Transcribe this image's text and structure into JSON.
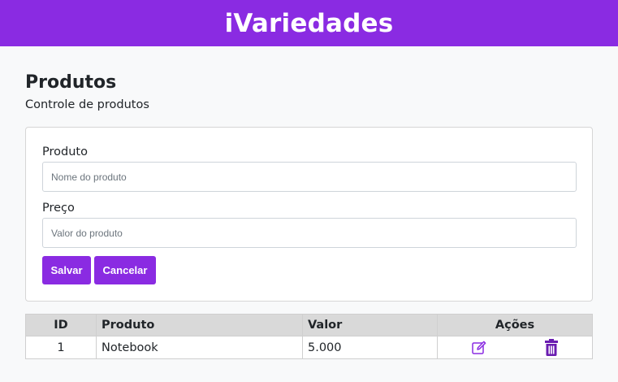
{
  "navbar": {
    "brand": "iVariedades",
    "color": "#8a2be2"
  },
  "page": {
    "title": "Produtos",
    "subtitle": "Controle de produtos"
  },
  "form": {
    "product_label": "Produto",
    "product_placeholder": "Nome do produto",
    "product_value": "",
    "price_label": "Preço",
    "price_placeholder": "Valor do produto",
    "price_value": "",
    "save_label": "Salvar",
    "cancel_label": "Cancelar"
  },
  "table": {
    "headers": {
      "id": "ID",
      "product": "Produto",
      "value": "Valor",
      "actions": "Ações"
    },
    "rows": [
      {
        "id": "1",
        "product": "Notebook",
        "value": "5.000",
        "edit_icon": "edit-icon",
        "delete_icon": "trash-icon"
      }
    ]
  }
}
